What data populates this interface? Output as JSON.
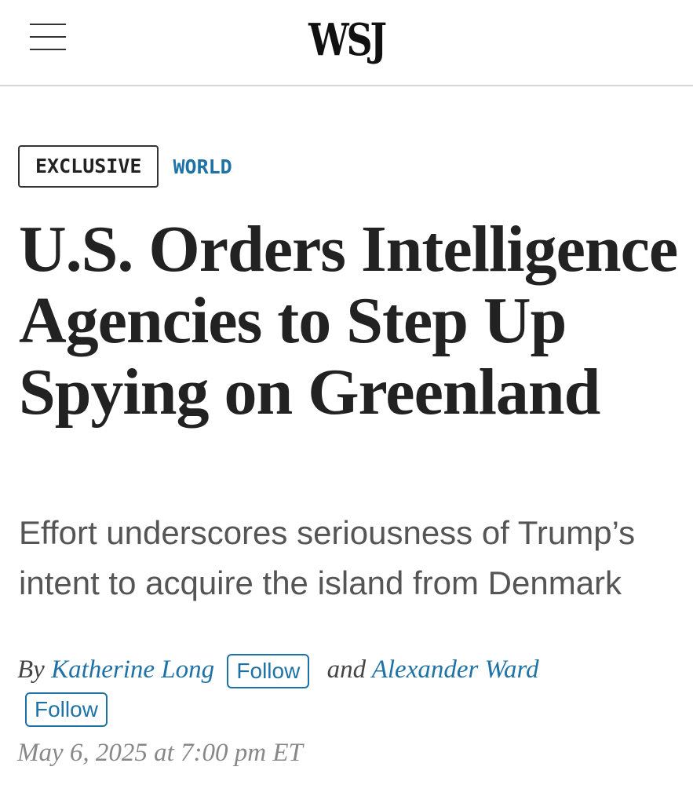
{
  "header": {
    "logo": "WSJ",
    "menu_icon": "hamburger-menu-icon"
  },
  "tags": {
    "label": "EXCLUSIVE",
    "section": "WORLD"
  },
  "article": {
    "headline": "U.S. Orders Intelligence Agencies to Step Up Spying on Greenland",
    "dek": "Effort underscores seriousness of Trump’s intent to acquire the island from Denmark"
  },
  "byline": {
    "prefix": "By",
    "conjunction": "and",
    "authors": [
      {
        "name": "Katherine Long",
        "follow_label": "Follow"
      },
      {
        "name": "Alexander Ward",
        "follow_label": "Follow"
      }
    ],
    "date": "May 6, 2025 at 7:00 pm ET"
  },
  "colors": {
    "accent": "#1f72a6",
    "text": "#222222",
    "muted": "#555555"
  }
}
